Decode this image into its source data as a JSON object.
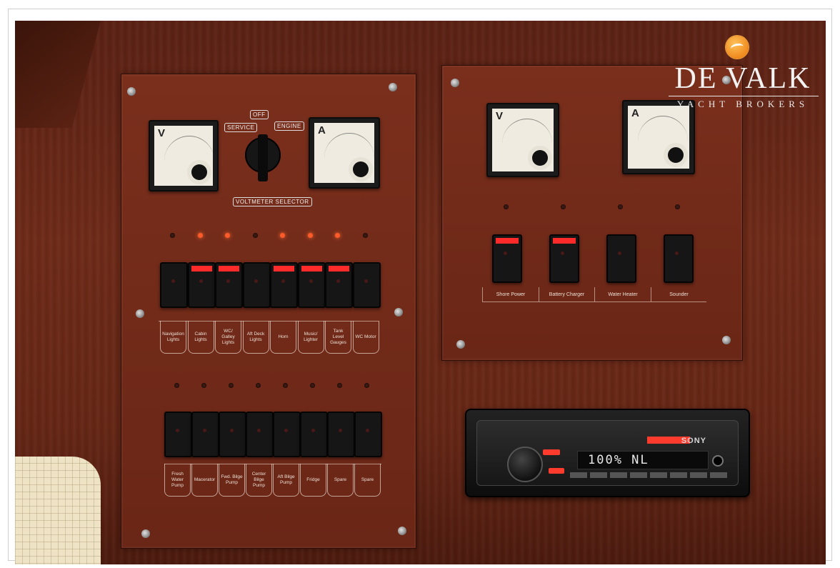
{
  "logo": {
    "name": "DE VALK",
    "subtitle": "YACHT BROKERS",
    "badge_color": "#ef8a1e"
  },
  "left_panel": {
    "meter_left_unit": "V",
    "meter_right_unit": "A",
    "selector_labels": {
      "off": "OFF",
      "service": "SERVICE",
      "engine": "ENGINE",
      "title": "VOLTMETER SELECTOR"
    },
    "row1_leds_on": [
      false,
      true,
      true,
      false,
      true,
      true,
      true,
      false
    ],
    "row1_switch_red": [
      false,
      true,
      true,
      false,
      true,
      true,
      true,
      false
    ],
    "row1_labels": [
      "Navigation Lights",
      "Cabin Lights",
      "WC/ Galley Lights",
      "Aft Deck Lights",
      "Horn",
      "Music/ Lighter",
      "Tank Level Gauges",
      "WC Motor"
    ],
    "row2_labels": [
      "Fresh Water Pump",
      "Macerator",
      "Fwd. Bilge Pump",
      "Center Bilge Pump",
      "Aft Bilge Pump",
      "Fridge",
      "Spare",
      "Spare"
    ]
  },
  "right_panel": {
    "meter_left_unit": "V",
    "meter_right_unit": "A",
    "switch_red": [
      true,
      true,
      false,
      false
    ],
    "labels": [
      "Shore Power",
      "Battery Charger",
      "Water Heater",
      "Sounder"
    ]
  },
  "radio": {
    "brand": "SONY",
    "display": "100% NL"
  },
  "colors": {
    "wood": "#6e2a18",
    "led_on": "#ff5a2a",
    "switch_red": "#ff2a2a"
  }
}
